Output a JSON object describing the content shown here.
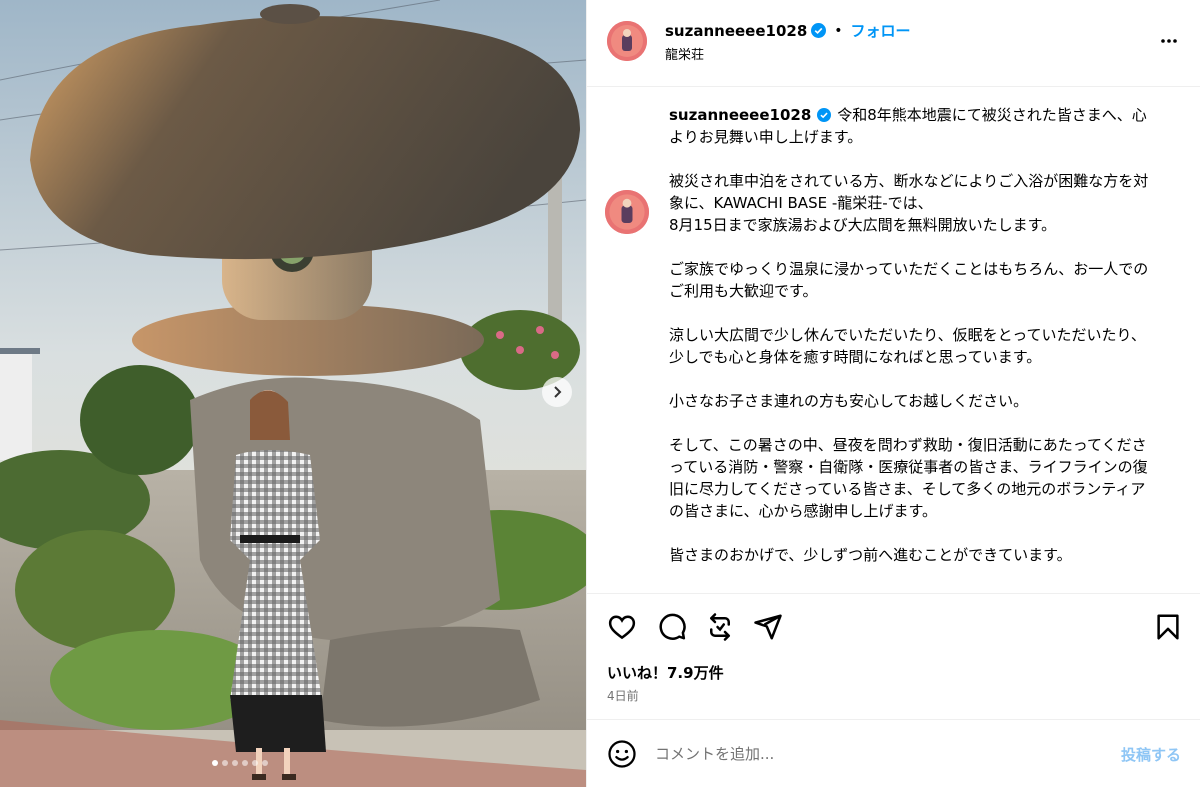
{
  "post": {
    "username": "suzanneeee1028",
    "follow_label": "フォロー",
    "bullet": "•",
    "location": "龍栄荘",
    "caption_paragraphs": [
      "令和8年熊本地震にて被災された皆さまへ、心よりお見舞い申し上げます。",
      "被災され車中泊をされている方、断水などによりご入浴が困難な方を対象に、KAWACHI BASE -龍栄荘-では、\n8月15日まで家族湯および大広間を無料開放いたします。",
      "ご家族でゆっくり温泉に浸かっていただくことはもちろん、お一人でのご利用も大歓迎です。",
      "涼しい大広間で少し休んでいただいたり、仮眠をとっていただいたり、少しでも心と身体を癒す時間になればと思っています。",
      "小さなお子さま連れの方も安心してお越しください。",
      "そして、この暑さの中、昼夜を問わず救助・復旧活動にあたってくださっている消防・警察・自衛隊・医療従事者の皆さま、ライフラインの復旧に尽力してくださっている皆さま、そして多くの地元のボランティアの皆さまに、心から感謝申し上げます。",
      "皆さまのおかげで、少しずつ前へ進むことができています。"
    ],
    "likes": "いいね！7.9万件",
    "time_ago": "4日前"
  },
  "comment": {
    "placeholder": "コメントを追加...",
    "post_label": "投稿する"
  },
  "icons": {
    "more": "more-options-icon",
    "like": "heart-icon",
    "comment": "comment-icon",
    "repost": "repost-icon",
    "share": "share-icon",
    "save": "bookmark-icon",
    "emoji": "emoji-icon",
    "verified": "verified-badge-icon",
    "next": "chevron-right-icon"
  },
  "carousel": {
    "slide_count": 6,
    "current_index": 1
  },
  "colors": {
    "link": "#0095f6",
    "verified": "#0095f6",
    "post_disabled": "#8fc6f5",
    "muted": "#737373"
  }
}
